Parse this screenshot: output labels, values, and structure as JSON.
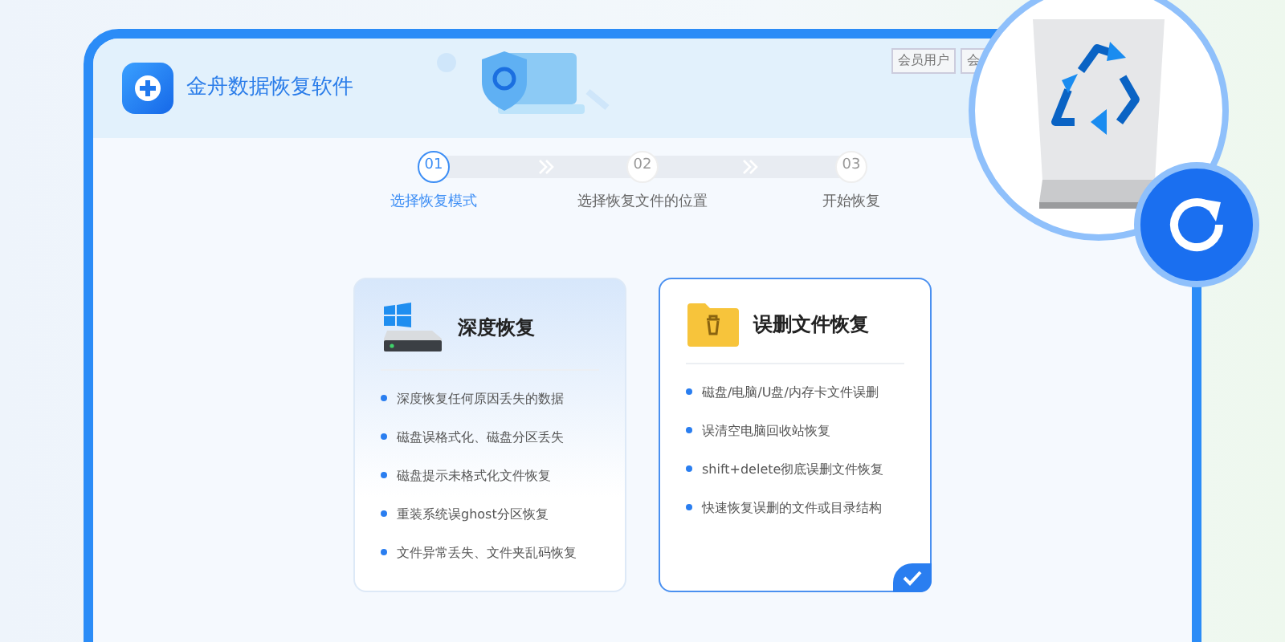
{
  "app": {
    "title": "金舟数据恢复软件"
  },
  "header_buttons": [
    {
      "label": "会员用户"
    },
    {
      "label": "会"
    }
  ],
  "steps": [
    {
      "number": "01",
      "label": "选择恢复模式",
      "selected": true
    },
    {
      "number": "02",
      "label": "选择恢复文件的位置",
      "selected": false
    },
    {
      "number": "03",
      "label": "开始恢复",
      "selected": false
    }
  ],
  "modes": [
    {
      "kind": "drive",
      "title": "深度恢复",
      "selected": false,
      "features": [
        "深度恢复任何原因丢失的数据",
        "磁盘误格式化、磁盘分区丢失",
        "磁盘提示未格式化文件恢复",
        "重装系统误ghost分区恢复",
        "文件异常丢失、文件夹乱码恢复"
      ]
    },
    {
      "kind": "folder",
      "title": "误删文件恢复",
      "selected": true,
      "features": [
        "磁盘/电脑/U盘/内存卡文件误删",
        "误清空电脑回收站恢复",
        "shift+delete彻底误删文件恢复",
        "快速恢复误删的文件或目录结构"
      ]
    }
  ]
}
